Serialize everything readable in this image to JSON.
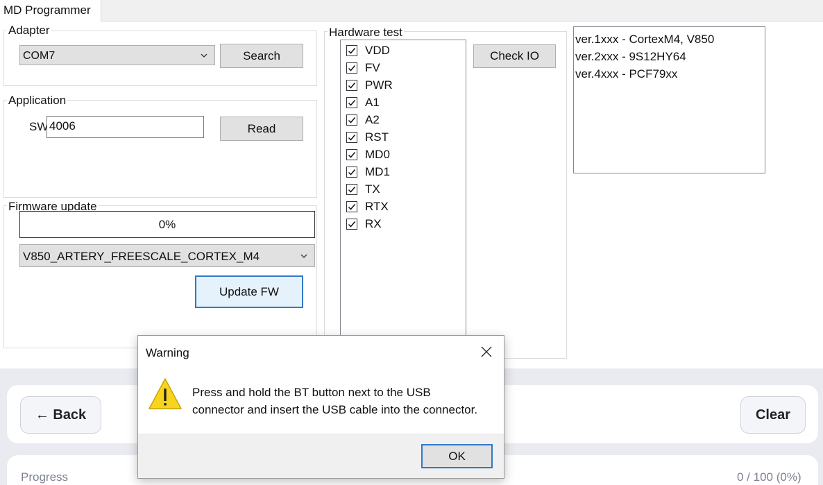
{
  "window": {
    "tab_title": "MD Programmer"
  },
  "adapter": {
    "title": "Adapter",
    "port_value": "COM7",
    "search_label": "Search"
  },
  "application": {
    "title": "Application",
    "sw_label": "SW:",
    "sw_value": "4006",
    "read_label": "Read"
  },
  "firmware": {
    "title": "Firmware update",
    "progress_text": "0%",
    "progress_value": 0,
    "target_value": "V850_ARTERY_FREESCALE_CORTEX_M4",
    "update_label": "Update FW"
  },
  "hardware": {
    "title": "Hardware test",
    "check_io_label": "Check IO",
    "signals": [
      {
        "label": "VDD",
        "checked": true
      },
      {
        "label": "FV",
        "checked": true
      },
      {
        "label": "PWR",
        "checked": true
      },
      {
        "label": "A1",
        "checked": true
      },
      {
        "label": "A2",
        "checked": true
      },
      {
        "label": "RST",
        "checked": true
      },
      {
        "label": "MD0",
        "checked": true
      },
      {
        "label": "MD1",
        "checked": true
      },
      {
        "label": "TX",
        "checked": true
      },
      {
        "label": "RTX",
        "checked": true
      },
      {
        "label": "RX",
        "checked": true
      }
    ]
  },
  "versions": {
    "items": [
      "ver.1xxx - CortexM4, V850",
      "ver.2xxx - 9S12HY64",
      "ver.4xxx - PCF79xx"
    ]
  },
  "bottom": {
    "back_label": "← Back",
    "clear_label": "Clear",
    "progress_label": "Progress",
    "progress_count": "0 / 100 (0%)"
  },
  "dialog": {
    "title": "Warning",
    "message_line1": "Press and hold the BT button next to the USB",
    "message_line2": "connector and insert the USB cable into the connector.",
    "ok_label": "OK",
    "icon": "warning-icon"
  },
  "colors": {
    "accent": "#2f78c7",
    "warning_yellow": "#f7d51e"
  }
}
